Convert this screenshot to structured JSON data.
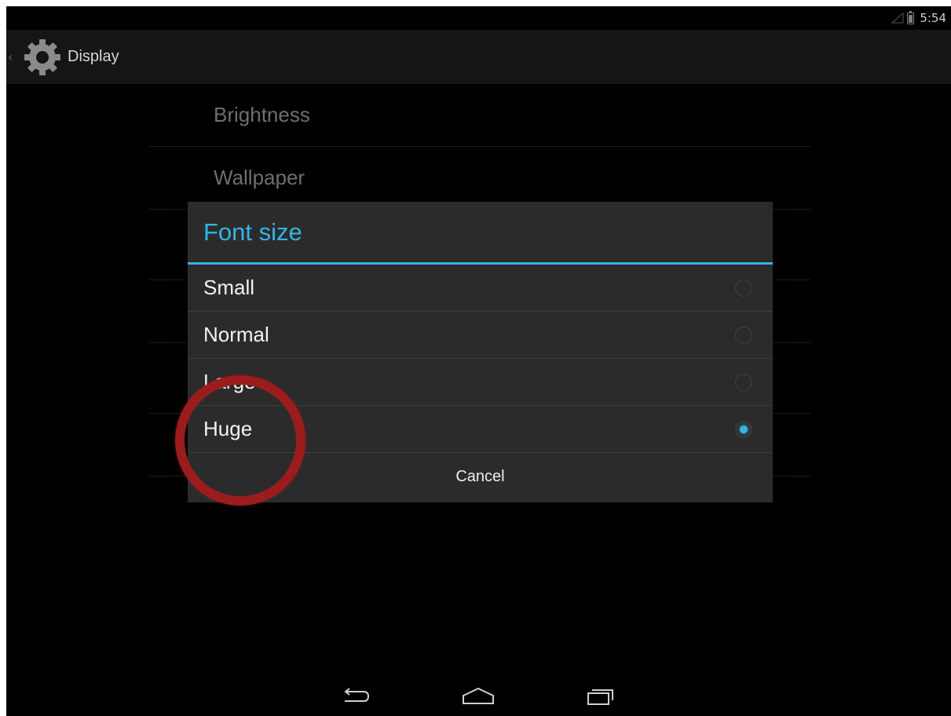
{
  "status_bar": {
    "clock": "5:54"
  },
  "action_bar": {
    "title": "Display"
  },
  "settings": {
    "items": [
      {
        "label": "Brightness"
      },
      {
        "label": "Wallpaper"
      },
      {
        "label": ""
      },
      {
        "label": ""
      },
      {
        "label": ""
      },
      {
        "label": ""
      }
    ]
  },
  "dialog": {
    "title": "Font size",
    "options": [
      {
        "label": "Small",
        "selected": false
      },
      {
        "label": "Normal",
        "selected": false
      },
      {
        "label": "Large",
        "selected": false
      },
      {
        "label": "Huge",
        "selected": true
      }
    ],
    "cancel_label": "Cancel"
  },
  "colors": {
    "accent": "#33b5e5",
    "annotation": "#9b1c1c",
    "dialog_bg": "#2b2b2b",
    "screen_bg": "#000000"
  },
  "icons": [
    "signal-icon",
    "battery-icon",
    "up-caret-icon",
    "gear-icon",
    "back-icon",
    "home-icon",
    "recent-apps-icon"
  ]
}
